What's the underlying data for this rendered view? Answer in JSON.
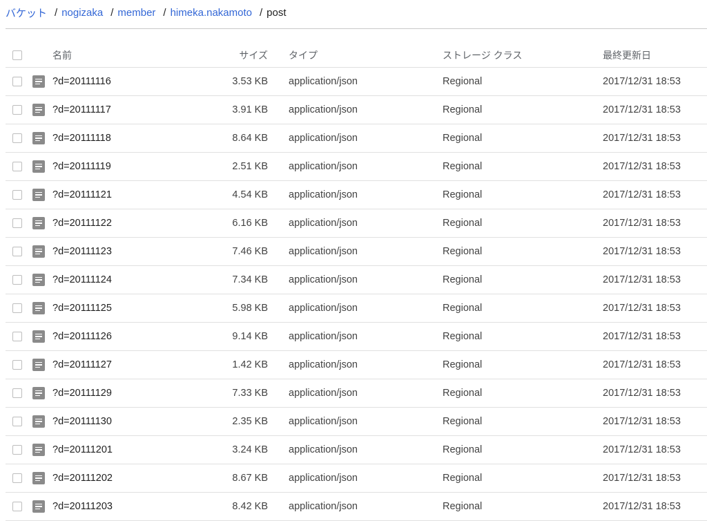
{
  "breadcrumb": {
    "items": [
      "バケット",
      "nogizaka",
      "member",
      "himeka.nakamoto"
    ],
    "separator": "/",
    "current": "post"
  },
  "table": {
    "headers": {
      "name": "名前",
      "size": "サイズ",
      "type": "タイプ",
      "storage_class": "ストレージ クラス",
      "updated": "最終更新日"
    },
    "rows": [
      {
        "name": "?d=20111116",
        "size": "3.53 KB",
        "type": "application/json",
        "storage_class": "Regional",
        "updated": "2017/12/31 18:53"
      },
      {
        "name": "?d=20111117",
        "size": "3.91 KB",
        "type": "application/json",
        "storage_class": "Regional",
        "updated": "2017/12/31 18:53"
      },
      {
        "name": "?d=20111118",
        "size": "8.64 KB",
        "type": "application/json",
        "storage_class": "Regional",
        "updated": "2017/12/31 18:53"
      },
      {
        "name": "?d=20111119",
        "size": "2.51 KB",
        "type": "application/json",
        "storage_class": "Regional",
        "updated": "2017/12/31 18:53"
      },
      {
        "name": "?d=20111121",
        "size": "4.54 KB",
        "type": "application/json",
        "storage_class": "Regional",
        "updated": "2017/12/31 18:53"
      },
      {
        "name": "?d=20111122",
        "size": "6.16 KB",
        "type": "application/json",
        "storage_class": "Regional",
        "updated": "2017/12/31 18:53"
      },
      {
        "name": "?d=20111123",
        "size": "7.46 KB",
        "type": "application/json",
        "storage_class": "Regional",
        "updated": "2017/12/31 18:53"
      },
      {
        "name": "?d=20111124",
        "size": "7.34 KB",
        "type": "application/json",
        "storage_class": "Regional",
        "updated": "2017/12/31 18:53"
      },
      {
        "name": "?d=20111125",
        "size": "5.98 KB",
        "type": "application/json",
        "storage_class": "Regional",
        "updated": "2017/12/31 18:53"
      },
      {
        "name": "?d=20111126",
        "size": "9.14 KB",
        "type": "application/json",
        "storage_class": "Regional",
        "updated": "2017/12/31 18:53"
      },
      {
        "name": "?d=20111127",
        "size": "1.42 KB",
        "type": "application/json",
        "storage_class": "Regional",
        "updated": "2017/12/31 18:53"
      },
      {
        "name": "?d=20111129",
        "size": "7.33 KB",
        "type": "application/json",
        "storage_class": "Regional",
        "updated": "2017/12/31 18:53"
      },
      {
        "name": "?d=20111130",
        "size": "2.35 KB",
        "type": "application/json",
        "storage_class": "Regional",
        "updated": "2017/12/31 18:53"
      },
      {
        "name": "?d=20111201",
        "size": "3.24 KB",
        "type": "application/json",
        "storage_class": "Regional",
        "updated": "2017/12/31 18:53"
      },
      {
        "name": "?d=20111202",
        "size": "8.67 KB",
        "type": "application/json",
        "storage_class": "Regional",
        "updated": "2017/12/31 18:53"
      },
      {
        "name": "?d=20111203",
        "size": "8.42 KB",
        "type": "application/json",
        "storage_class": "Regional",
        "updated": "2017/12/31 18:53"
      }
    ]
  },
  "icons": {
    "row_icon": "file-document-icon",
    "checkbox": "checkbox-unchecked"
  },
  "colors": {
    "link": "#3367d6",
    "text": "#212121",
    "muted": "#5f6368",
    "divider": "#e0e0e0",
    "file_icon": "#8a8a8a"
  }
}
